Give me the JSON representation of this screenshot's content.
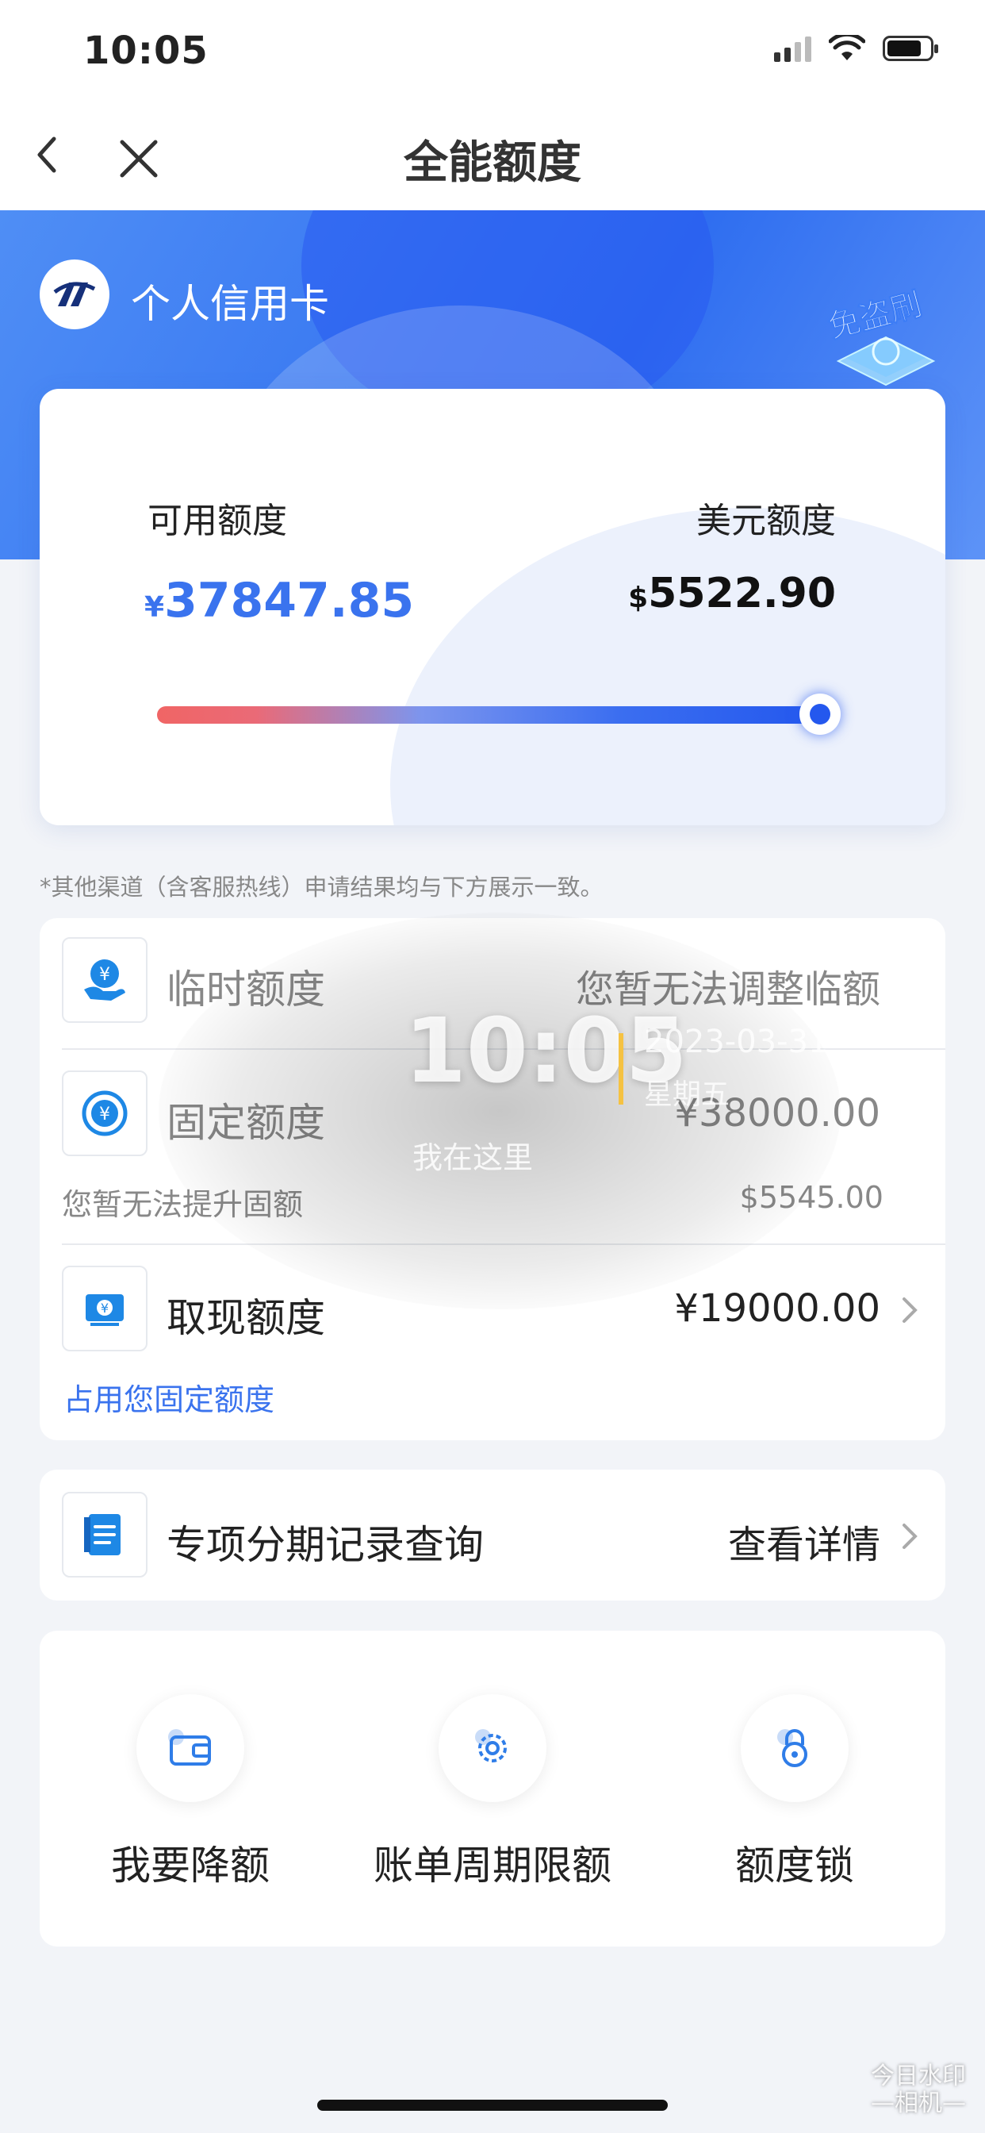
{
  "status_bar": {
    "time": "10:05"
  },
  "nav": {
    "title": "全能额度"
  },
  "banner": {
    "bank_name": "个人信用卡",
    "badge_text": "免盗刷"
  },
  "limit_card": {
    "available_label": "可用额度",
    "available_currency": "¥",
    "available_value": "37847.85",
    "usd_label": "美元额度",
    "usd_currency": "$",
    "usd_value": "5522.90",
    "slider_fraction": 1.0
  },
  "notice": "*其他渠道（含客服热线）申请结果均与下方展示一致。",
  "quota_rows": {
    "temporary": {
      "title": "临时额度",
      "value": "您暂无法调整临额"
    },
    "fixed": {
      "title": "固定额度",
      "value": "¥38000.00",
      "sub_label": "您暂无法提升固额",
      "sub_value": "$5545.00"
    },
    "cash": {
      "title": "取现额度",
      "value": "¥19000.00",
      "sub_label": "占用您固定额度"
    }
  },
  "installment": {
    "title": "专项分期记录查询",
    "action": "查看详情"
  },
  "tools": [
    {
      "label": "我要降额",
      "icon": "wallet-icon"
    },
    {
      "label": "账单周期限额",
      "icon": "gear-icon"
    },
    {
      "label": "额度锁",
      "icon": "lock-icon"
    }
  ],
  "watermark": {
    "time": "10:05",
    "date": "2023-03-31",
    "weekday": "星期五",
    "location": "我在这里",
    "brand_line1": "今日水印",
    "brand_line2": "—相机—"
  },
  "colors": {
    "accent": "#3a73ee",
    "banner": "#2f6ef0"
  }
}
